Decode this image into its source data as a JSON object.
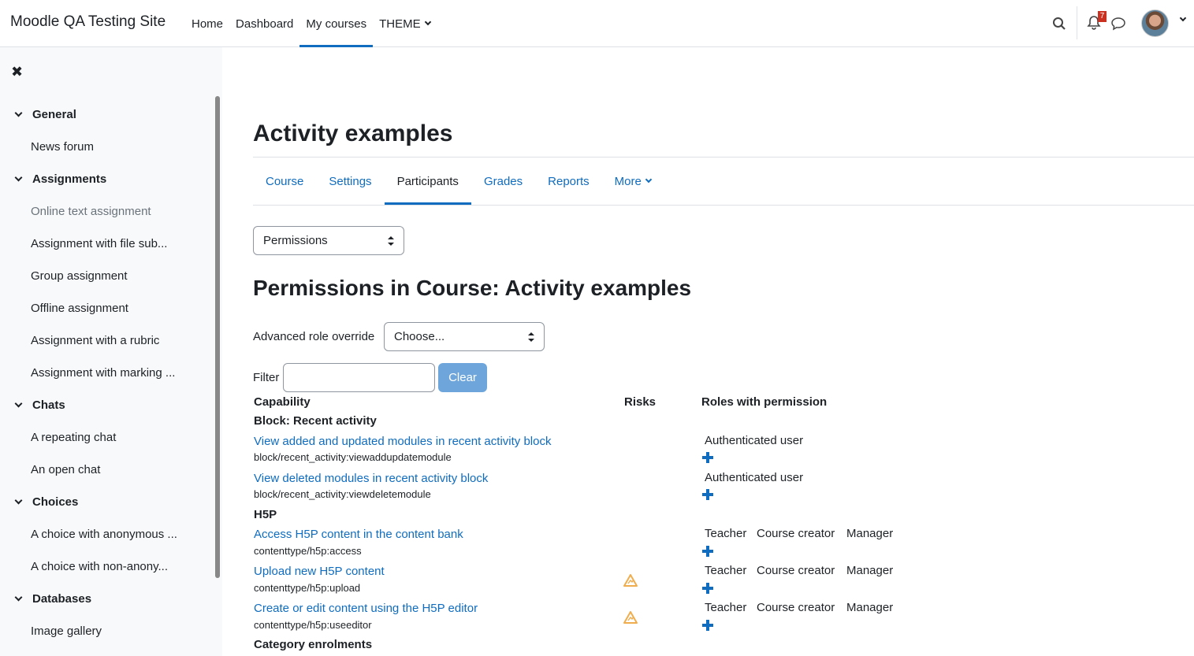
{
  "navbar": {
    "site_name": "Moodle QA Testing Site",
    "items": [
      {
        "label": "Home"
      },
      {
        "label": "Dashboard"
      },
      {
        "label": "My courses"
      },
      {
        "label": "THEME"
      }
    ],
    "notification_count": "7"
  },
  "drawer": {
    "sections": [
      {
        "label": "General",
        "items": [
          "News forum"
        ]
      },
      {
        "label": "Assignments",
        "items": [
          "Online text assignment",
          "Assignment with file sub...",
          "Group assignment",
          "Offline assignment",
          "Assignment with a rubric",
          "Assignment with marking ..."
        ]
      },
      {
        "label": "Chats",
        "items": [
          "A repeating chat",
          "An open chat"
        ]
      },
      {
        "label": "Choices",
        "items": [
          "A choice with anonymous ...",
          "A choice with non-anony..."
        ]
      },
      {
        "label": "Databases",
        "items": [
          "Image gallery"
        ]
      }
    ]
  },
  "page": {
    "title": "Activity examples",
    "tabs": [
      "Course",
      "Settings",
      "Participants",
      "Grades",
      "Reports",
      "More"
    ],
    "selector_value": "Permissions",
    "heading": "Permissions in Course: Activity examples",
    "override_label": "Advanced role override",
    "override_value": "Choose...",
    "filter_label": "Filter",
    "filter_value": "",
    "clear_label": "Clear"
  },
  "table": {
    "headers": {
      "capability": "Capability",
      "risks": "Risks",
      "roles": "Roles with permission"
    },
    "groups": [
      {
        "name": "Block: Recent activity",
        "rows": [
          {
            "title": "View added and updated modules in recent activity block",
            "name": "block/recent_activity:viewaddupdatemodule",
            "risk": false,
            "roles": [
              "Authenticated user"
            ]
          },
          {
            "title": "View deleted modules in recent activity block",
            "name": "block/recent_activity:viewdeletemodule",
            "risk": false,
            "roles": [
              "Authenticated user"
            ]
          }
        ]
      },
      {
        "name": "H5P",
        "rows": [
          {
            "title": "Access H5P content in the content bank",
            "name": "contenttype/h5p:access",
            "risk": false,
            "roles": [
              "Teacher",
              "Course creator",
              "Manager"
            ]
          },
          {
            "title": "Upload new H5P content",
            "name": "contenttype/h5p:upload",
            "risk": true,
            "roles": [
              "Teacher",
              "Course creator",
              "Manager"
            ]
          },
          {
            "title": "Create or edit content using the H5P editor",
            "name": "contenttype/h5p:useeditor",
            "risk": true,
            "roles": [
              "Teacher",
              "Course creator",
              "Manager"
            ]
          }
        ]
      },
      {
        "name": "Category enrolments",
        "rows": []
      }
    ]
  },
  "colors": {
    "accent": "#0f6cbf",
    "risk": "#f0ad4e"
  }
}
